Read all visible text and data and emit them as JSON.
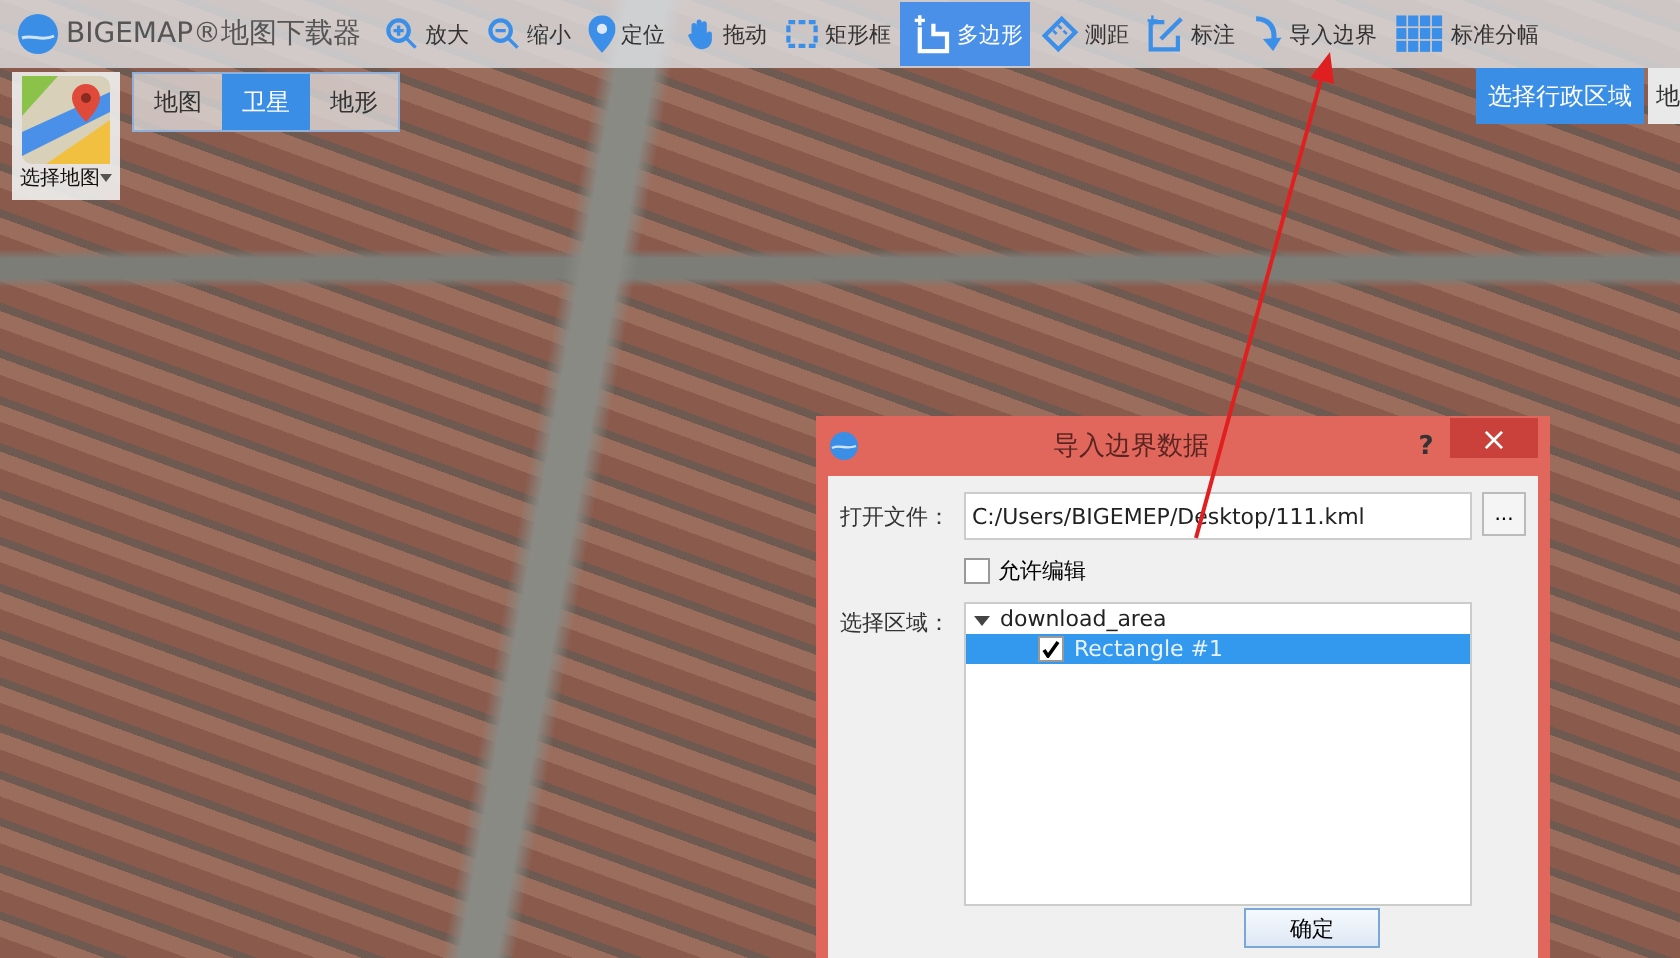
{
  "brand": "BIGEMAP®地图下载器",
  "toolbar": [
    {
      "label": "放大",
      "kind": "zoom-in",
      "selected": false
    },
    {
      "label": "缩小",
      "kind": "zoom-out",
      "selected": false
    },
    {
      "label": "定位",
      "kind": "pin",
      "selected": false
    },
    {
      "label": "拖动",
      "kind": "hand",
      "selected": false
    },
    {
      "label": "矩形框",
      "kind": "rect",
      "selected": false
    },
    {
      "label": "多边形",
      "kind": "polygon",
      "selected": true
    },
    {
      "label": "测距",
      "kind": "ruler",
      "selected": false
    },
    {
      "label": "标注",
      "kind": "mark",
      "selected": false
    },
    {
      "label": "导入边界",
      "kind": "import",
      "selected": false
    },
    {
      "label": "标准分幅",
      "kind": "grid",
      "selected": false
    }
  ],
  "region_button": "选择行政区域",
  "region_cut": "地",
  "map_selector": {
    "label": "选择地图"
  },
  "map_types": [
    {
      "label": "地图",
      "selected": false
    },
    {
      "label": "卫星",
      "selected": true
    },
    {
      "label": "地形",
      "selected": false
    }
  ],
  "dialog": {
    "title": "导入边界数据",
    "help": "?",
    "close": "×",
    "file_label": "打开文件：",
    "file_value": "C:/Users/BIGEMEP/Desktop/111.kml",
    "browse": "...",
    "allow_edit": {
      "label": "允许编辑",
      "checked": false
    },
    "area_label": "选择区域：",
    "tree": [
      {
        "label": "download_area",
        "expanded": true,
        "children": [
          {
            "label": "Rectangle #1",
            "checked": true,
            "selected": true
          }
        ]
      }
    ],
    "ok": "确定"
  }
}
